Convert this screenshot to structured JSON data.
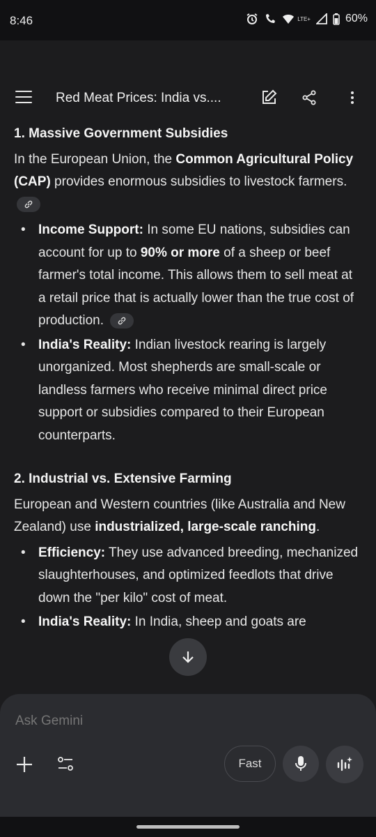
{
  "status": {
    "time": "8:46",
    "network": "LTE+",
    "battery": "60%"
  },
  "appbar": {
    "title": "Red Meat Prices: India vs...."
  },
  "section1": {
    "heading": "1. Massive Government Subsidies",
    "intro_pre": "In the European Union, the ",
    "intro_bold": "Common Agricultural Policy (CAP)",
    "intro_post": " provides enormous subsidies to livestock farmers.",
    "bullet1_label": "Income Support:",
    "bullet1_pre": " In some EU nations, subsidies can account for up to ",
    "bullet1_bold": "90% or more",
    "bullet1_post": " of a sheep or beef farmer's total income. This allows them to sell meat at a retail price that is actually lower than the true cost of production.",
    "bullet2_label": "India's Reality:",
    "bullet2_text": " Indian livestock rearing is largely unorganized. Most shepherds are small-scale or landless farmers who receive minimal direct price support or subsidies compared to their European counterparts."
  },
  "section2": {
    "heading": "2. Industrial vs. Extensive Farming",
    "intro_pre": "European and Western countries (like Australia and New Zealand) use ",
    "intro_bold": "industrialized, large-scale ranching",
    "intro_post": ".",
    "bullet1_label": "Efficiency:",
    "bullet1_text": " They use advanced breeding, mechanized slaughterhouses, and optimized feedlots that drive down the \"per kilo\" cost of meat.",
    "bullet2_label": "India's Reality:",
    "bullet2_text": " In India, sheep and goats are"
  },
  "composer": {
    "placeholder": "Ask Gemini",
    "mode_label": "Fast"
  }
}
